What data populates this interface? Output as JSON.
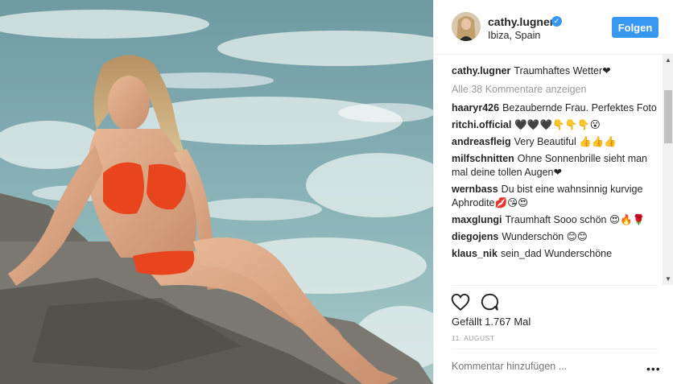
{
  "post": {
    "username": "cathy.lugner",
    "verified_icon": "check-icon",
    "location": "Ibiza, Spain",
    "follow_label": "Folgen",
    "accent_color": "#3897f0"
  },
  "caption": {
    "user": "cathy.lugner",
    "text": "Traumhaftes Wetter❤"
  },
  "load_more": "Alle 38 Kommentare anzeigen",
  "comments": [
    {
      "user": "haaryr426",
      "text": "Bezaubernde Frau. Perfektes Foto"
    },
    {
      "user": "ritchi.official",
      "text": "🖤🖤🖤👇👇👇😮"
    },
    {
      "user": "andreasfleig",
      "text": "Very Beautiful 👍👍👍"
    },
    {
      "user": "milfschnitten",
      "text": "Ohne Sonnenbrille sieht man mal deine tollen Augen❤"
    },
    {
      "user": "wernbass",
      "text": "Du bist eine wahnsinnig kurvige Aphrodite💋😘😍"
    },
    {
      "user": "maxglungi",
      "text": "Traumhaft Sooo schön 😍🔥🌹"
    },
    {
      "user": "diegojens",
      "text": "Wunderschön 😊😊"
    },
    {
      "user": "klaus_nik",
      "text": "sein_dad Wunderschöne"
    }
  ],
  "likes_text": "Gefällt 1.767 Mal",
  "date_text": "11. AUGUST",
  "add_comment_placeholder": "Kommentar hinzufügen ...",
  "more_label": "•••",
  "icons": {
    "like": "heart-icon",
    "comment": "comment-icon",
    "more": "more-options-icon"
  }
}
